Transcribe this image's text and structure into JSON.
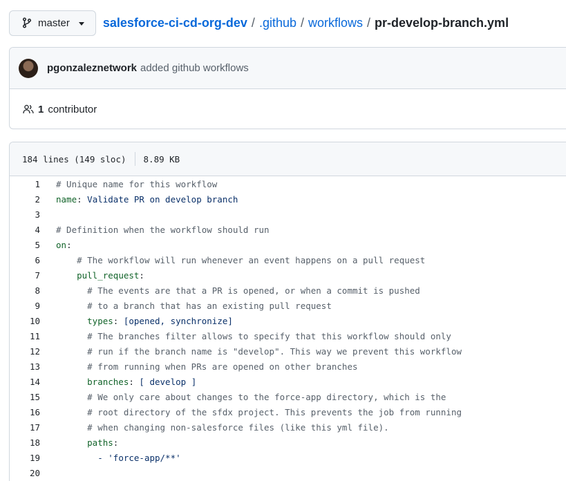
{
  "branch": {
    "name": "master"
  },
  "breadcrumb": {
    "repo": "salesforce-ci-cd-org-dev",
    "dir1": ".github",
    "dir2": "workflows",
    "file": "pr-develop-branch.yml",
    "sep": "/"
  },
  "commit": {
    "author": "pgonzaleznetwork",
    "message": "added github workflows"
  },
  "contributors": {
    "count": "1",
    "label": "contributor"
  },
  "file_info": {
    "lines": "184 lines (149 sloc)",
    "size": "8.89 KB"
  },
  "code_lines": [
    {
      "n": "1",
      "indent": "",
      "key": "",
      "rest": "",
      "comment": "# Unique name for this workflow"
    },
    {
      "n": "2",
      "indent": "",
      "key": "name",
      "rest": ": Validate PR on develop branch",
      "comment": ""
    },
    {
      "n": "3",
      "indent": "",
      "key": "",
      "rest": "",
      "comment": ""
    },
    {
      "n": "4",
      "indent": "",
      "key": "",
      "rest": "",
      "comment": "# Definition when the workflow should run"
    },
    {
      "n": "5",
      "indent": "",
      "key": "on",
      "rest": ":",
      "comment": ""
    },
    {
      "n": "6",
      "indent": "    ",
      "key": "",
      "rest": "",
      "comment": "# The workflow will run whenever an event happens on a pull request"
    },
    {
      "n": "7",
      "indent": "    ",
      "key": "pull_request",
      "rest": ":",
      "comment": ""
    },
    {
      "n": "8",
      "indent": "      ",
      "key": "",
      "rest": "",
      "comment": "# The events are that a PR is opened, or when a commit is pushed"
    },
    {
      "n": "9",
      "indent": "      ",
      "key": "",
      "rest": "",
      "comment": "# to a branch that has an existing pull request"
    },
    {
      "n": "10",
      "indent": "      ",
      "key": "types",
      "rest": ": [opened, synchronize]",
      "comment": ""
    },
    {
      "n": "11",
      "indent": "      ",
      "key": "",
      "rest": "",
      "comment": "# The branches filter allows to specify that this workflow should only"
    },
    {
      "n": "12",
      "indent": "      ",
      "key": "",
      "rest": "",
      "comment": "# run if the branch name is \"develop\". This way we prevent this workflow"
    },
    {
      "n": "13",
      "indent": "      ",
      "key": "",
      "rest": "",
      "comment": "# from running when PRs are opened on other branches"
    },
    {
      "n": "14",
      "indent": "      ",
      "key": "branches",
      "rest": ": [ develop ]",
      "comment": ""
    },
    {
      "n": "15",
      "indent": "      ",
      "key": "",
      "rest": "",
      "comment": "# We only care about changes to the force-app directory, which is the"
    },
    {
      "n": "16",
      "indent": "      ",
      "key": "",
      "rest": "",
      "comment": "# root directory of the sfdx project. This prevents the job from running"
    },
    {
      "n": "17",
      "indent": "      ",
      "key": "",
      "rest": "",
      "comment": "# when changing non-salesforce files (like this yml file)."
    },
    {
      "n": "18",
      "indent": "      ",
      "key": "paths",
      "rest": ":",
      "comment": ""
    },
    {
      "n": "19",
      "indent": "        ",
      "key": "",
      "rest": "- 'force-app/**'",
      "comment": ""
    },
    {
      "n": "20",
      "indent": "",
      "key": "",
      "rest": "",
      "comment": ""
    }
  ],
  "colors": {
    "link": "#0969da",
    "comment": "#57606a",
    "yaml_key": "#116329",
    "yaml_value": "#0a3069",
    "border": "#d0d7de",
    "header_bg": "#f6f8fa"
  },
  "icons": {
    "branch": "git-branch-icon",
    "contributors": "people-icon",
    "caret": "caret-down-icon"
  }
}
